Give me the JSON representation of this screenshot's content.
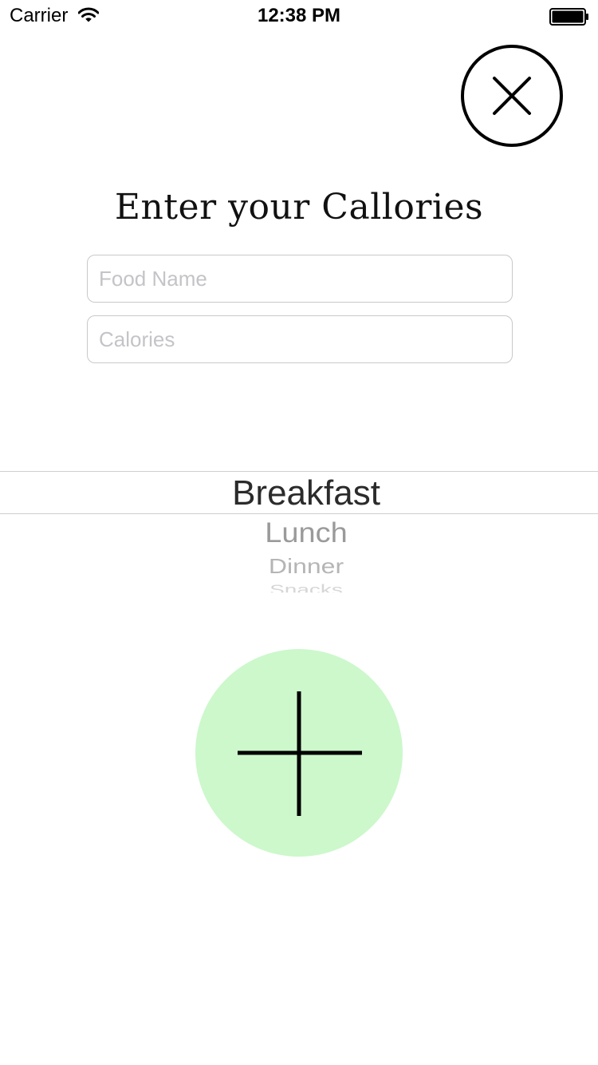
{
  "status_bar": {
    "carrier": "Carrier",
    "time": "12:38 PM",
    "wifi_icon": "wifi-icon",
    "battery_icon": "battery-icon"
  },
  "close_button": {
    "icon": "close-icon"
  },
  "title": "Enter your Callories",
  "form": {
    "food_name_placeholder": "Food Name",
    "food_name_value": "",
    "calories_placeholder": "Calories",
    "calories_value": ""
  },
  "meal_picker": {
    "selected": "Breakfast",
    "options": [
      "Breakfast",
      "Lunch",
      "Dinner",
      "Snacks"
    ]
  },
  "add_button": {
    "icon": "plus-icon",
    "color": "#ccf8cb"
  }
}
